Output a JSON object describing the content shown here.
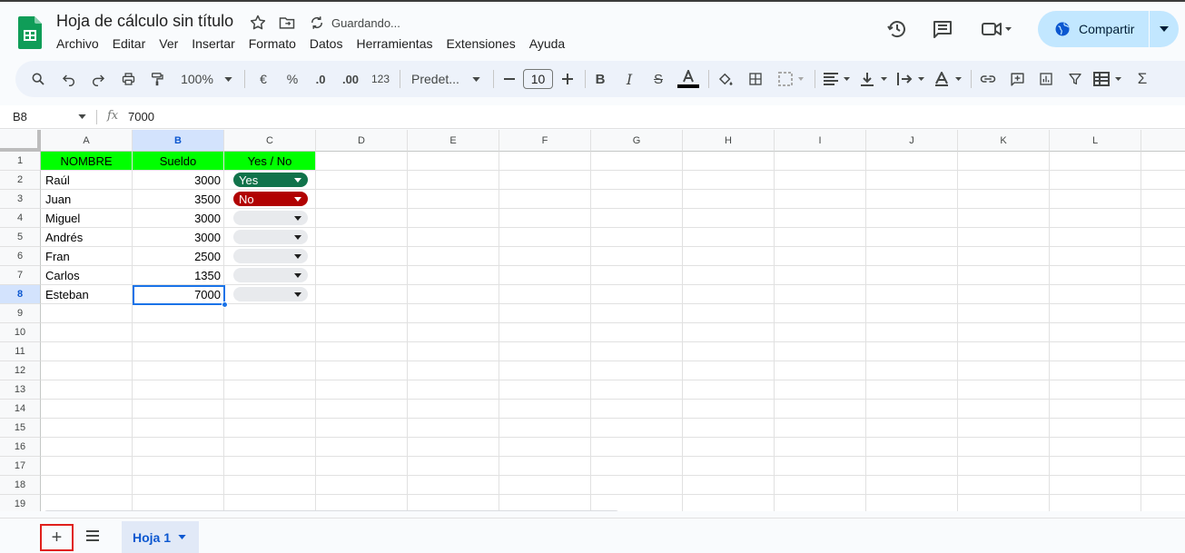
{
  "doc": {
    "title": "Hoja de cálculo sin título",
    "status": "Guardando..."
  },
  "menu": [
    "Archivo",
    "Editar",
    "Ver",
    "Insertar",
    "Formato",
    "Datos",
    "Herramientas",
    "Extensiones",
    "Ayuda"
  ],
  "share": {
    "label": "Compartir"
  },
  "toolbar": {
    "zoom": "100%",
    "currency": "€",
    "percent": "%",
    "dec_decrease": ".0",
    "dec_increase": ".00",
    "more_formats": "123",
    "font": "Predet...",
    "font_size": "10"
  },
  "formula_bar": {
    "cell_ref": "B8",
    "fx": "fx",
    "value": "7000"
  },
  "columns": [
    "A",
    "B",
    "C",
    "D",
    "E",
    "F",
    "G",
    "H",
    "I",
    "J",
    "K",
    "L"
  ],
  "rows": [
    "1",
    "2",
    "3",
    "4",
    "5",
    "6",
    "7",
    "8",
    "9",
    "10",
    "11",
    "12",
    "13",
    "14",
    "15",
    "16",
    "17",
    "18",
    "19"
  ],
  "table": {
    "headers": [
      "NOMBRE",
      "Sueldo",
      "Yes / No"
    ],
    "records": [
      {
        "name": "Raúl",
        "salary": "3000",
        "status": "Yes"
      },
      {
        "name": "Juan",
        "salary": "3500",
        "status": "No"
      },
      {
        "name": "Miguel",
        "salary": "3000",
        "status": ""
      },
      {
        "name": "Andrés",
        "salary": "3000",
        "status": ""
      },
      {
        "name": "Fran",
        "salary": "2500",
        "status": ""
      },
      {
        "name": "Carlos",
        "salary": "1350",
        "status": ""
      },
      {
        "name": "Esteban",
        "salary": "7000",
        "status": ""
      }
    ]
  },
  "sheets": {
    "add": "+",
    "active_tab": "Hoja 1"
  },
  "colors": {
    "header_fill": "#00ff00",
    "yes_chip": "#11734b",
    "no_chip": "#b10202",
    "selection": "#1a73e8",
    "share_bg": "#c2e7ff"
  }
}
